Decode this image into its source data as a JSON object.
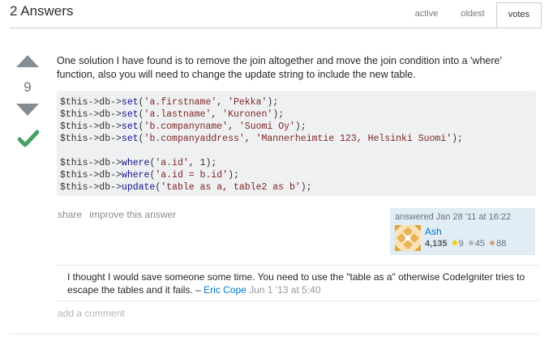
{
  "header": {
    "title": "2 Answers",
    "tabs": [
      {
        "label": "active"
      },
      {
        "label": "oldest"
      },
      {
        "label": "votes"
      }
    ],
    "selected_tab": "votes"
  },
  "answer": {
    "vote_count": "9",
    "accepted": true,
    "body": "One solution I have found is to remove the join altogether and move the join condition into a 'where' function, also you will need to change the update string to include the new table.",
    "code_lines": [
      [
        {
          "t": "$this->db->",
          "c": "p"
        },
        {
          "t": "set",
          "c": "k"
        },
        {
          "t": "(",
          "c": "p"
        },
        {
          "t": "'a.firstname'",
          "c": "s"
        },
        {
          "t": ", ",
          "c": "p"
        },
        {
          "t": "'Pekka'",
          "c": "s"
        },
        {
          "t": ");",
          "c": "p"
        }
      ],
      [
        {
          "t": "$this->db->",
          "c": "p"
        },
        {
          "t": "set",
          "c": "k"
        },
        {
          "t": "(",
          "c": "p"
        },
        {
          "t": "'a.lastname'",
          "c": "s"
        },
        {
          "t": ", ",
          "c": "p"
        },
        {
          "t": "'Kuronen'",
          "c": "s"
        },
        {
          "t": ");",
          "c": "p"
        }
      ],
      [
        {
          "t": "$this->db->",
          "c": "p"
        },
        {
          "t": "set",
          "c": "k"
        },
        {
          "t": "(",
          "c": "p"
        },
        {
          "t": "'b.companyname'",
          "c": "s"
        },
        {
          "t": ", ",
          "c": "p"
        },
        {
          "t": "'Suomi Oy'",
          "c": "s"
        },
        {
          "t": ");",
          "c": "p"
        }
      ],
      [
        {
          "t": "$this->db->",
          "c": "p"
        },
        {
          "t": "set",
          "c": "k"
        },
        {
          "t": "(",
          "c": "p"
        },
        {
          "t": "'b.companyaddress'",
          "c": "s"
        },
        {
          "t": ", ",
          "c": "p"
        },
        {
          "t": "'Mannerheimtie 123, Helsinki Suomi'",
          "c": "s"
        },
        {
          "t": ");",
          "c": "p"
        }
      ],
      [],
      [
        {
          "t": "$this->db->",
          "c": "p"
        },
        {
          "t": "where",
          "c": "k"
        },
        {
          "t": "(",
          "c": "p"
        },
        {
          "t": "'a.id'",
          "c": "s"
        },
        {
          "t": ", 1);",
          "c": "p"
        }
      ],
      [
        {
          "t": "$this->db->",
          "c": "p"
        },
        {
          "t": "where",
          "c": "k"
        },
        {
          "t": "(",
          "c": "p"
        },
        {
          "t": "'a.id = b.id'",
          "c": "s"
        },
        {
          "t": ");",
          "c": "p"
        }
      ],
      [
        {
          "t": "$this->db->",
          "c": "p"
        },
        {
          "t": "update",
          "c": "k"
        },
        {
          "t": "(",
          "c": "p"
        },
        {
          "t": "'table as a, table2 as b'",
          "c": "s"
        },
        {
          "t": ");",
          "c": "p"
        }
      ]
    ],
    "menu": {
      "share": "share",
      "improve": "improve this answer"
    },
    "signature": {
      "action": "answered Jan 28 '11 at 16:22",
      "user_name": "Ash",
      "reputation": "4,135",
      "gold": "9",
      "silver": "45",
      "bronze": "88"
    }
  },
  "comment": {
    "text": "I thought I would save someone some time. You need to use the \"table as a\" otherwise CodeIgniter tries to escape the tables and it fails. – ",
    "user": "Eric Cope",
    "date": "Jun 1 '13 at 5:40"
  },
  "add_comment": "add a comment",
  "colors": {
    "accepted": "#45a163",
    "gold": "#ffcc01",
    "silver": "#b4b8bc",
    "bronze": "#d1a684",
    "link": "#0077cc"
  }
}
